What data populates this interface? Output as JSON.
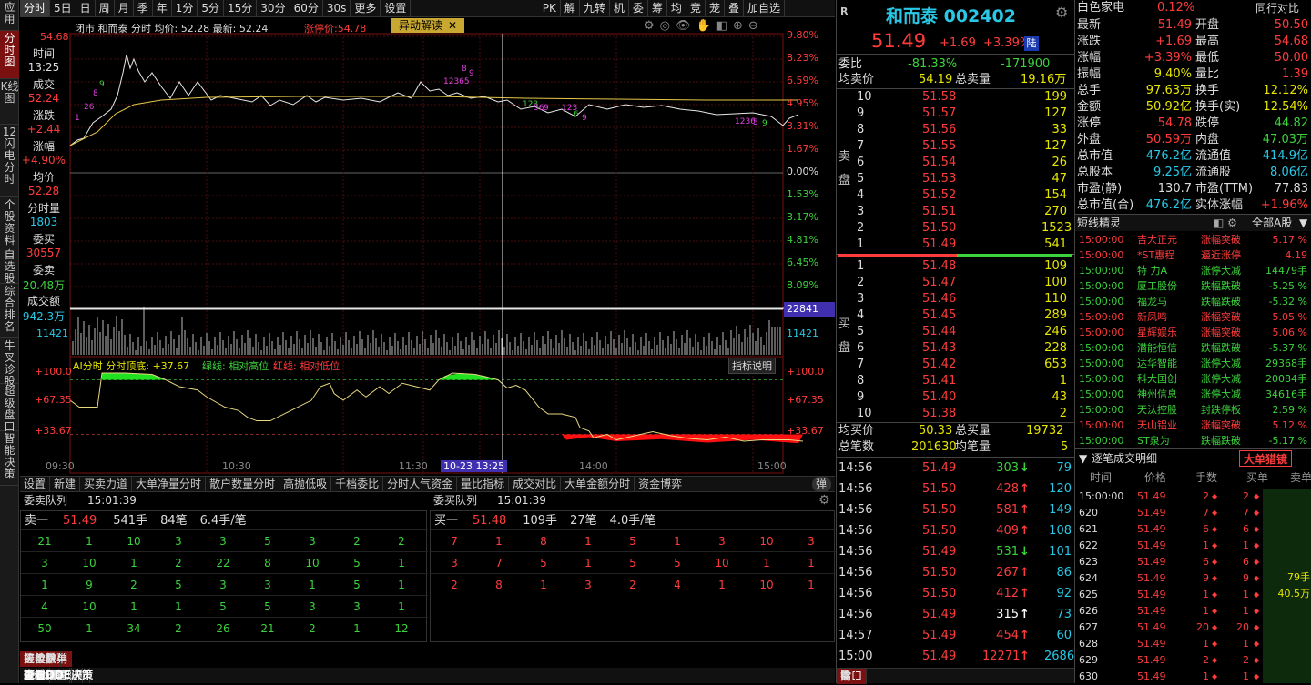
{
  "left_tabs": [
    "应用",
    "分时图",
    "K线图",
    "12闪电分时",
    "个股资料",
    "自选股",
    "综合排名",
    "牛叉诊股",
    "超级盘口",
    "智能决策"
  ],
  "toolbar": {
    "items": [
      "分时",
      "5日",
      "日",
      "周",
      "月",
      "季",
      "年",
      "1分",
      "5分",
      "15分",
      "30分",
      "60分",
      "30s",
      "更多",
      "设置"
    ],
    "popup": "异动解读",
    "right": [
      "PK",
      "解",
      "九转",
      "机",
      "委",
      "筹",
      "均",
      "竞",
      "茏",
      "叠",
      "加自选"
    ]
  },
  "chart": {
    "header": "闭市  和而泰  分时  均价: 52.28  最新: 52.24",
    "limit_label": "涨停价:54.78",
    "price_ticks": [
      "54.68",
      "",
      "",
      "",
      "",
      "",
      "",
      "",
      "",
      "",
      ""
    ],
    "right_pct": [
      "9.80%",
      "8.23%",
      "6.59%",
      "4.95%",
      "3.31%",
      "1.67%",
      "0.00%",
      "1.53%",
      "3.17%",
      "4.81%",
      "6.45%",
      "8.09%",
      "9.80%"
    ],
    "vol_ticks": [
      "22841",
      "11421"
    ],
    "vol_left": "11421",
    "ai_label": "AI分时  分时顶底: +37.67",
    "ai_legend_green": "绿线: 相对高位",
    "ai_legend_red": "红线: 相对低位",
    "ai_btn": "指标说明",
    "ai_ticks": [
      "+100.0",
      "+67.35",
      "+33.67"
    ],
    "time_ticks": [
      "09:30",
      "10:30",
      "11:30",
      "14:00",
      "15:00"
    ],
    "cursor_time": "10-23 13:25"
  },
  "side_labels": [
    {
      "k": "时间",
      "v": "13:25",
      "c": "white"
    },
    {
      "k": "成交",
      "v": "52.24",
      "c": "red"
    },
    {
      "k": "涨跌",
      "v": "+2.44",
      "c": "red"
    },
    {
      "k": "涨幅",
      "v": "+4.90%",
      "c": "red"
    },
    {
      "k": "均价",
      "v": "52.28",
      "c": "red"
    },
    {
      "k": "分时量",
      "v": "1803",
      "c": "cyan"
    },
    {
      "k": "委买",
      "v": "30557",
      "c": "red"
    },
    {
      "k": "委卖",
      "v": "20.48万",
      "c": "green"
    },
    {
      "k": "成交额",
      "v": "942.3万",
      "c": "cyan"
    }
  ],
  "bottom_tabs": [
    "设置",
    "新建",
    "买卖力道",
    "大单净量分时",
    "散户数量分时",
    "高抛低吸",
    "千档委比",
    "分时人气资金",
    "量比指标",
    "成交对比",
    "大单金额分时",
    "资金博弈"
  ],
  "bottom_tabs_end": "弹",
  "queue": {
    "sell_title": "委卖队列",
    "sell_time": "15:01:39",
    "buy_title": "委买队列",
    "buy_time": "15:01:39",
    "sell_head": [
      "卖一",
      "51.49",
      "541手",
      "84笔",
      "6.4手/笔"
    ],
    "buy_head": [
      "买一",
      "51.48",
      "109手",
      "27笔",
      "4.0手/笔"
    ],
    "sell_rows": [
      [
        "21",
        "1",
        "10",
        "3",
        "3",
        "5",
        "3",
        "2",
        "2"
      ],
      [
        "3",
        "10",
        "1",
        "2",
        "22",
        "8",
        "10",
        "5",
        "1"
      ],
      [
        "1",
        "9",
        "2",
        "5",
        "3",
        "3",
        "1",
        "5",
        "1"
      ],
      [
        "4",
        "10",
        "1",
        "1",
        "5",
        "5",
        "3",
        "3",
        "1"
      ],
      [
        "50",
        "1",
        "34",
        "2",
        "26",
        "21",
        "2",
        "1",
        "12"
      ]
    ],
    "buy_rows": [
      [
        "7",
        "1",
        "8",
        "1",
        "5",
        "1",
        "3",
        "10",
        "3"
      ],
      [
        "3",
        "7",
        "5",
        "1",
        "5",
        "5",
        "10",
        "1",
        "1"
      ],
      [
        "2",
        "8",
        "1",
        "3",
        "2",
        "4",
        "1",
        "10",
        "1"
      ]
    ],
    "tabs": [
      "买卖队列",
      "挂单撤单",
      "分价表",
      "拖拉机单"
    ],
    "footer": [
      "Level-2行情",
      "关联报价",
      "AI相似个股",
      "可比公司",
      "行业监控",
      "资讯",
      "个股扫雷",
      "持股ETF"
    ],
    "dde": "查看DDE决策"
  },
  "quote": {
    "name": "和而泰 002402",
    "price": "51.49",
    "chg": "+1.69",
    "pct": "+3.39%",
    "tag": "陆",
    "webi": "委比",
    "webi_v": "-81.33%",
    "webi_v2": "-171900",
    "avg": "均卖价",
    "avg_v": "54.19",
    "tot": "总卖量",
    "tot_v": "19.16万",
    "asks": [
      [
        "10",
        "51.58",
        "199"
      ],
      [
        "9",
        "51.57",
        "127"
      ],
      [
        "8",
        "51.56",
        "33"
      ],
      [
        "7",
        "51.55",
        "127"
      ],
      [
        "6",
        "51.54",
        "26"
      ],
      [
        "5",
        "51.53",
        "47"
      ],
      [
        "4",
        "51.52",
        "154"
      ],
      [
        "3",
        "51.51",
        "270"
      ],
      [
        "2",
        "51.50",
        "1523"
      ],
      [
        "1",
        "51.49",
        "541"
      ]
    ],
    "bids": [
      [
        "1",
        "51.48",
        "109"
      ],
      [
        "2",
        "51.47",
        "100"
      ],
      [
        "3",
        "51.46",
        "110"
      ],
      [
        "4",
        "51.45",
        "289"
      ],
      [
        "5",
        "51.44",
        "246"
      ],
      [
        "6",
        "51.43",
        "228"
      ],
      [
        "7",
        "51.42",
        "653"
      ],
      [
        "8",
        "51.41",
        "1"
      ],
      [
        "9",
        "51.40",
        "43"
      ],
      [
        "10",
        "51.38",
        "2"
      ]
    ],
    "sell_side": "卖盘",
    "buy_side": "买盘",
    "bavg": "均买价",
    "bavg_v": "50.33",
    "btot": "总买量",
    "btot_v": "19732",
    "tn": "总笔数",
    "tn_v": "201630",
    "avgn": "均笔量",
    "avgn_v": "5",
    "ticks": [
      [
        "14:56",
        "51.49",
        "303",
        "down",
        "79"
      ],
      [
        "14:56",
        "51.50",
        "428",
        "up",
        "120"
      ],
      [
        "14:56",
        "51.50",
        "581",
        "up",
        "149"
      ],
      [
        "14:56",
        "51.50",
        "409",
        "up",
        "108"
      ],
      [
        "14:56",
        "51.49",
        "531",
        "down",
        "101"
      ],
      [
        "14:56",
        "51.50",
        "267",
        "up",
        "86"
      ],
      [
        "14:56",
        "51.50",
        "412",
        "up",
        "92"
      ],
      [
        "14:56",
        "51.49",
        "315",
        "upw",
        "73"
      ],
      [
        "14:57",
        "51.49",
        "454",
        "up",
        "60"
      ],
      [
        "15:00",
        "51.49",
        "12271",
        "up",
        "2686"
      ]
    ],
    "foot": [
      "盘口",
      "指",
      "诊",
      "K",
      "财",
      "注"
    ]
  },
  "stats": {
    "sector": "白色家电",
    "sector_pct": "0.12%",
    "sector_btn": "同行对比",
    "rows": [
      [
        "最新",
        "51.49",
        "r",
        "开盘",
        "50.50",
        "r"
      ],
      [
        "涨跌",
        "+1.69",
        "r",
        "最高",
        "54.68",
        "r"
      ],
      [
        "涨幅",
        "+3.39%",
        "r",
        "最低",
        "50.00",
        "r"
      ],
      [
        "振幅",
        "9.40%",
        "y",
        "量比",
        "1.39",
        "r"
      ],
      [
        "总手",
        "97.63万",
        "y",
        "换手",
        "12.12%",
        "y"
      ],
      [
        "金额",
        "50.92亿",
        "y",
        "换手(实)",
        "12.54%",
        "y"
      ],
      [
        "涨停",
        "54.78",
        "r",
        "跌停",
        "44.82",
        "g"
      ],
      [
        "外盘",
        "50.59万",
        "r",
        "内盘",
        "47.03万",
        "g"
      ],
      [
        "总市值",
        "476.2亿",
        "c",
        "流通值",
        "414.9亿",
        "c"
      ],
      [
        "总股本",
        "9.25亿",
        "c",
        "流通股",
        "8.06亿",
        "c"
      ],
      [
        "市盈(静)",
        "130.7",
        "w",
        "市盈(TTM)",
        "77.83",
        "w"
      ],
      [
        "总市值(合)",
        "476.2亿",
        "c",
        "实体涨幅",
        "+1.96%",
        "r"
      ]
    ]
  },
  "sprite": {
    "title": "短线精灵",
    "filter": "全部A股",
    "items": [
      [
        "15:00:00",
        "吉大正元",
        "涨幅突破",
        "5.17 %",
        "r"
      ],
      [
        "15:00:00",
        "*ST惠程",
        "逼近涨停",
        "4.19",
        "r"
      ],
      [
        "15:00:00",
        "特  力A",
        "涨停大减",
        "14479手",
        "g"
      ],
      [
        "15:00:00",
        "厦工股份",
        "跌幅跌破",
        "-5.25 %",
        "g"
      ],
      [
        "15:00:00",
        "福龙马",
        "跌幅跌破",
        "-5.32 %",
        "g"
      ],
      [
        "15:00:00",
        "新凤鸣",
        "涨幅突破",
        "5.05 %",
        "r"
      ],
      [
        "15:00:00",
        "星辉娱乐",
        "涨幅突破",
        "5.06 %",
        "r"
      ],
      [
        "15:00:00",
        "潜能恒信",
        "跌幅跌破",
        "-5.37 %",
        "g"
      ],
      [
        "15:00:00",
        "达华智能",
        "涨停大减",
        "29368手",
        "g"
      ],
      [
        "15:00:00",
        "科大国创",
        "涨停大减",
        "20084手",
        "g"
      ],
      [
        "15:00:00",
        "神州信息",
        "涨停大减",
        "34616手",
        "g"
      ],
      [
        "15:00:00",
        "天汰控股",
        "封跌停板",
        "2.59 %",
        "g"
      ],
      [
        "15:00:00",
        "天山铝业",
        "涨幅突破",
        "5.12 %",
        "r"
      ],
      [
        "15:00:00",
        "ST泉为",
        "跌幅跌破",
        "-5.17 %",
        "g"
      ]
    ]
  },
  "detail": {
    "title": "逐笔成交明细",
    "btn": "大单猎镜",
    "head": [
      "时间",
      "价格",
      "手数",
      "买单",
      "卖单"
    ],
    "rows": [
      [
        "15:00:00",
        "51.49",
        "2",
        "2"
      ],
      [
        "620",
        "51.49",
        "7",
        "7"
      ],
      [
        "621",
        "51.49",
        "6",
        "6"
      ],
      [
        "622",
        "51.49",
        "1",
        "1"
      ],
      [
        "623",
        "51.49",
        "6",
        "6"
      ],
      [
        "624",
        "51.49",
        "9",
        "9"
      ],
      [
        "625",
        "51.49",
        "1",
        "1"
      ],
      [
        "626",
        "51.49",
        "1",
        "1"
      ],
      [
        "627",
        "51.49",
        "20",
        "20"
      ],
      [
        "628",
        "51.49",
        "1",
        "1"
      ],
      [
        "629",
        "51.49",
        "2",
        "2"
      ],
      [
        "630",
        "51.49",
        "1",
        "1"
      ]
    ],
    "big_hands": "79手",
    "big_amt": "40.5万"
  },
  "colors": {
    "red": "#ff3c3c",
    "green": "#3cd23c",
    "yellow": "#e6e600",
    "cyan": "#28c8e6"
  }
}
